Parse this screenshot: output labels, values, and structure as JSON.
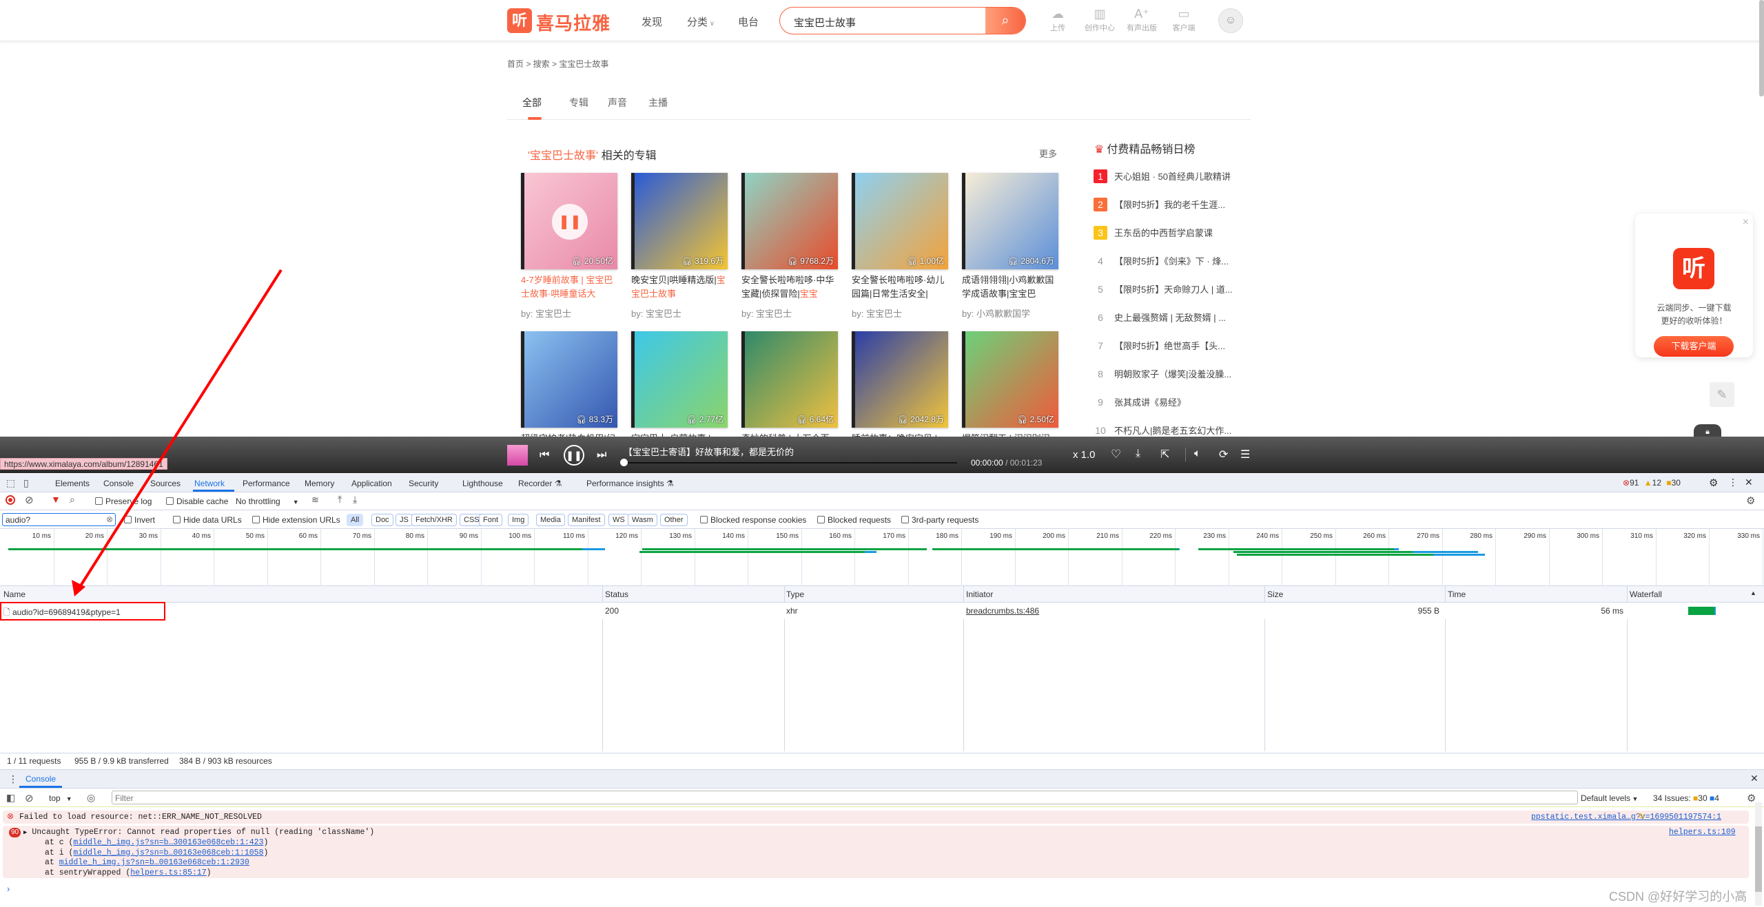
{
  "site": {
    "logo_icon": "听",
    "logo_text": "喜马拉雅",
    "nav": [
      "发现",
      "分类",
      "电台"
    ],
    "search_value": "宝宝巴士故事",
    "header_icons": [
      {
        "icon": "upload-cloud-icon",
        "glyph": "☁",
        "label": "上传"
      },
      {
        "icon": "creator-center-icon",
        "glyph": "▥",
        "label": "创作中心"
      },
      {
        "icon": "audio-publish-icon",
        "glyph": "A⁺",
        "label": "有声出版"
      },
      {
        "icon": "desktop-client-icon",
        "glyph": "▭",
        "label": "客户端"
      }
    ],
    "breadcrumb": "首页 > 搜索 > 宝宝巴士故事",
    "tabs": [
      "全部",
      "专辑",
      "声音",
      "主播"
    ],
    "section_keyword": "'宝宝巴士故事'",
    "section_suffix": "相关的专辑",
    "more": "更多",
    "albums": [
      {
        "title": "4-7岁睡前故事 | 宝宝巴士故事·哄睡童话大",
        "hl": "",
        "by": "by:  宝宝巴士",
        "plays": "20.50亿",
        "playing": true,
        "c1": "#f8c6d4",
        "c2": "#e98aa8"
      },
      {
        "title": "晚安宝贝|哄睡精选版|",
        "hl": "宝宝巴士故事",
        "by": "by:  宝宝巴士",
        "plays": "319.6万",
        "c1": "#2a5bd7",
        "c2": "#f5c531"
      },
      {
        "title": "安全警长啦咘啦哆·中华宝藏|侦探冒险|",
        "hl": "宝宝",
        "by": "by:  宝宝巴士",
        "plays": "9768.2万",
        "c1": "#8fd3c4",
        "c2": "#e84b2a"
      },
      {
        "title": "安全警长啦咘啦哆·幼儿园篇|日常生活安全|",
        "hl": "",
        "by": "by:  宝宝巴士",
        "plays": "1.00亿",
        "c1": "#8ed0f0",
        "c2": "#f3a23a"
      },
      {
        "title": "成语翎翎翎|小鸡歉歉国学成语故事|宝宝巴",
        "hl": "",
        "by": "by:  小鸡歉歉国学",
        "plays": "2804.6万",
        "c1": "#f6ecd6",
        "c2": "#5b8fd8"
      },
      {
        "title": "超级守护者|热血机甲|幻冒险|宝宝巴士",
        "hl": "",
        "by": "",
        "plays": "83.3万",
        "c1": "#8cc1f0",
        "c2": "#3457b0"
      },
      {
        "title": "宝宝巴士·启蒙故事 |",
        "hl": "",
        "by": "",
        "plays": "2.77亿",
        "c1": "#3ec8e8",
        "c2": "#8bd46a"
      },
      {
        "title": "奇妙的科普 | 十万个百 宝宝巴士为什",
        "hl": "",
        "by": "",
        "plays": "6.64亿",
        "c1": "#2f8a6a",
        "c2": "#f0c040"
      },
      {
        "title": "睡前故事：晚安宝贝 | 哄睡 | ",
        "hl": "宝宝巴士故事",
        "by": "",
        "plays": "2042.8万",
        "c1": "#2b3fa8",
        "c2": "#f2c53a"
      },
      {
        "title": "爆笑闹翻天 | 闹闹别闹 ·校园一分钟 | ",
        "hl": "宝宝巴",
        "by": "",
        "plays": "2.50亿",
        "c1": "#6cd17a",
        "c2": "#f05a3a"
      }
    ],
    "rank_title": "付费精品畅销日榜",
    "rank": [
      {
        "n": "1",
        "t": "天心姐姐 · 50首经典儿歌精讲",
        "c": "#f5222d"
      },
      {
        "n": "2",
        "t": "【限时5折】我的老千生涯...",
        "c": "#fa6e3a"
      },
      {
        "n": "3",
        "t": "王东岳的中西哲学启蒙课",
        "c": "#fcc419"
      },
      {
        "n": "4",
        "t": "【限时5折】《剑来》下 · 烽..."
      },
      {
        "n": "5",
        "t": "【限时5折】天命赊刀人 | 道..."
      },
      {
        "n": "6",
        "t": "史上最强赘婿 | 无敌赘婿 | ..."
      },
      {
        "n": "7",
        "t": "【限时5折】绝世高手【头..."
      },
      {
        "n": "8",
        "t": "明朝败家子（爆笑|没羞没臊..."
      },
      {
        "n": "9",
        "t": "张其成讲《易经》"
      },
      {
        "n": "10",
        "t": "不朽凡人|鹅是老五玄幻大作..."
      }
    ],
    "popup": {
      "line1": "云端同步、一键下载",
      "line2": "更好的收听体验！",
      "button": "下载客户端",
      "close": "×",
      "icon": "听"
    },
    "player": {
      "track": "【宝宝巴士寄语】好故事和爱，都是无价的",
      "current": "00:00:00",
      "total": "/ 00:01:23",
      "speed": "x 1.0",
      "progress": 0.0
    }
  },
  "url_tooltip": "https://www.ximalaya.com/album/12891461",
  "devtools": {
    "tabs": [
      "Elements",
      "Console",
      "Sources",
      "Network",
      "Performance",
      "Memory",
      "Application",
      "Security",
      "Lighthouse",
      "Recorder ⚗",
      "Performance insights ⚗"
    ],
    "active_tab": "Network",
    "counts": {
      "errors": "91",
      "warnings": "12",
      "info": "30"
    },
    "toolbar": {
      "preserve_log": "Preserve log",
      "disable_cache": "Disable cache",
      "throttling": "No throttling"
    },
    "filter_value": "audio?",
    "invert": "Invert",
    "hide_data": "Hide data URLs",
    "hide_ext": "Hide extension URLs",
    "types": [
      "All",
      "Doc",
      "JS",
      "Fetch/XHR",
      "CSS",
      "Font",
      "Img",
      "Media",
      "Manifest",
      "WS",
      "Wasm",
      "Other"
    ],
    "blocked_cookies": "Blocked response cookies",
    "blocked_requests": "Blocked requests",
    "third_party": "3rd-party requests",
    "ticks": [
      "10 ms",
      "20 ms",
      "30 ms",
      "40 ms",
      "50 ms",
      "60 ms",
      "70 ms",
      "80 ms",
      "90 ms",
      "100 ms",
      "110 ms",
      "120 ms",
      "130 ms",
      "140 ms",
      "150 ms",
      "160 ms",
      "170 ms",
      "180 ms",
      "190 ms",
      "200 ms",
      "210 ms",
      "220 ms",
      "230 ms",
      "240 ms",
      "250 ms",
      "260 ms",
      "270 ms",
      "280 ms",
      "290 ms",
      "300 ms",
      "310 ms",
      "320 ms",
      "330 ms"
    ],
    "columns": [
      "Name",
      "Status",
      "Type",
      "Initiator",
      "Size",
      "Time",
      "Waterfall"
    ],
    "rows": [
      {
        "name": "audio?id=69689419&ptype=1",
        "status": "200",
        "type": "xhr",
        "initiator": "breadcrumbs.ts:486",
        "size": "955 B",
        "time": "56 ms"
      }
    ],
    "summary": [
      "1 / 11 requests",
      "955 B / 9.9 kB transferred",
      "384 B / 903 kB resources"
    ],
    "console": {
      "tab": "Console",
      "context": "top",
      "filter_placeholder": "Filter",
      "levels": "Default levels",
      "issues": "34 Issues:",
      "issues_warn": "30",
      "issues_info": "4",
      "err1": "Failed to load resource: net::ERR_NAME_NOT_RESOLVED",
      "err1_src": "ppstatic.test.ximala…g?v=1699501197574:1",
      "err2_count": "90",
      "err2": "Uncaught TypeError: Cannot read properties of null (reading 'className')",
      "err2_src": "helpers.ts:109",
      "stack": [
        {
          "pre": "at c (",
          "link": "middle_h_img.js?sn=b…300163e068ceb:1:423",
          "post": ")"
        },
        {
          "pre": "at i (",
          "link": "middle_h_img.js?sn=b…00163e068ceb:1:1058",
          "post": ")"
        },
        {
          "pre": "at ",
          "link": "middle_h_img.js?sn=b…00163e068ceb:1:2930",
          "post": ""
        },
        {
          "pre": "at sentryWrapped (",
          "link": "helpers.ts:85:17",
          "post": ")"
        }
      ]
    }
  },
  "watermark": "CSDN @好好学习的小高",
  "colors": {
    "brand": "#f86442",
    "annotation": "#ff0000",
    "devtools_blue": "#1a73e8"
  }
}
